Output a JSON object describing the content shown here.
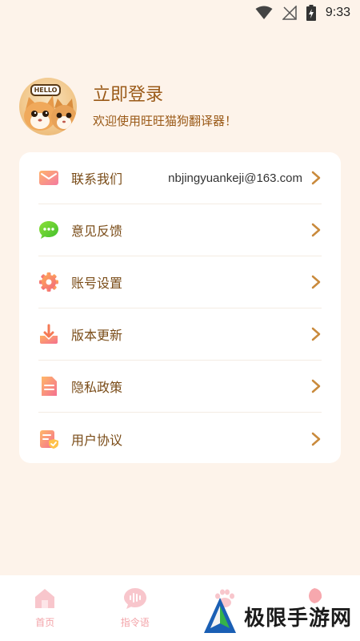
{
  "status_bar": {
    "time": "9:33"
  },
  "profile": {
    "avatar_text": "HELLO",
    "login_title": "立即登录",
    "welcome": "欢迎使用旺旺猫狗翻译器！"
  },
  "menu": {
    "items": [
      {
        "label": "联系我们",
        "value": "nbjingyuankeji@163.com",
        "icon": "mail-icon"
      },
      {
        "label": "意见反馈",
        "icon": "chat-bubble-icon"
      },
      {
        "label": "账号设置",
        "icon": "gear-icon"
      },
      {
        "label": "版本更新",
        "icon": "download-icon"
      },
      {
        "label": "隐私政策",
        "icon": "document-icon"
      },
      {
        "label": "用户协议",
        "icon": "agreement-icon"
      }
    ]
  },
  "tabs": [
    {
      "label": "首页",
      "icon": "home-icon"
    },
    {
      "label": "指令语",
      "icon": "voice-icon"
    },
    {
      "label": "",
      "icon": "paw-icon"
    },
    {
      "label": "",
      "icon": "profile-icon"
    }
  ],
  "watermark": {
    "text": "极限手游网"
  },
  "colors": {
    "background": "#fdf3ea",
    "accent": "#9a5a18",
    "tab_inactive": "#f3a3a8"
  }
}
